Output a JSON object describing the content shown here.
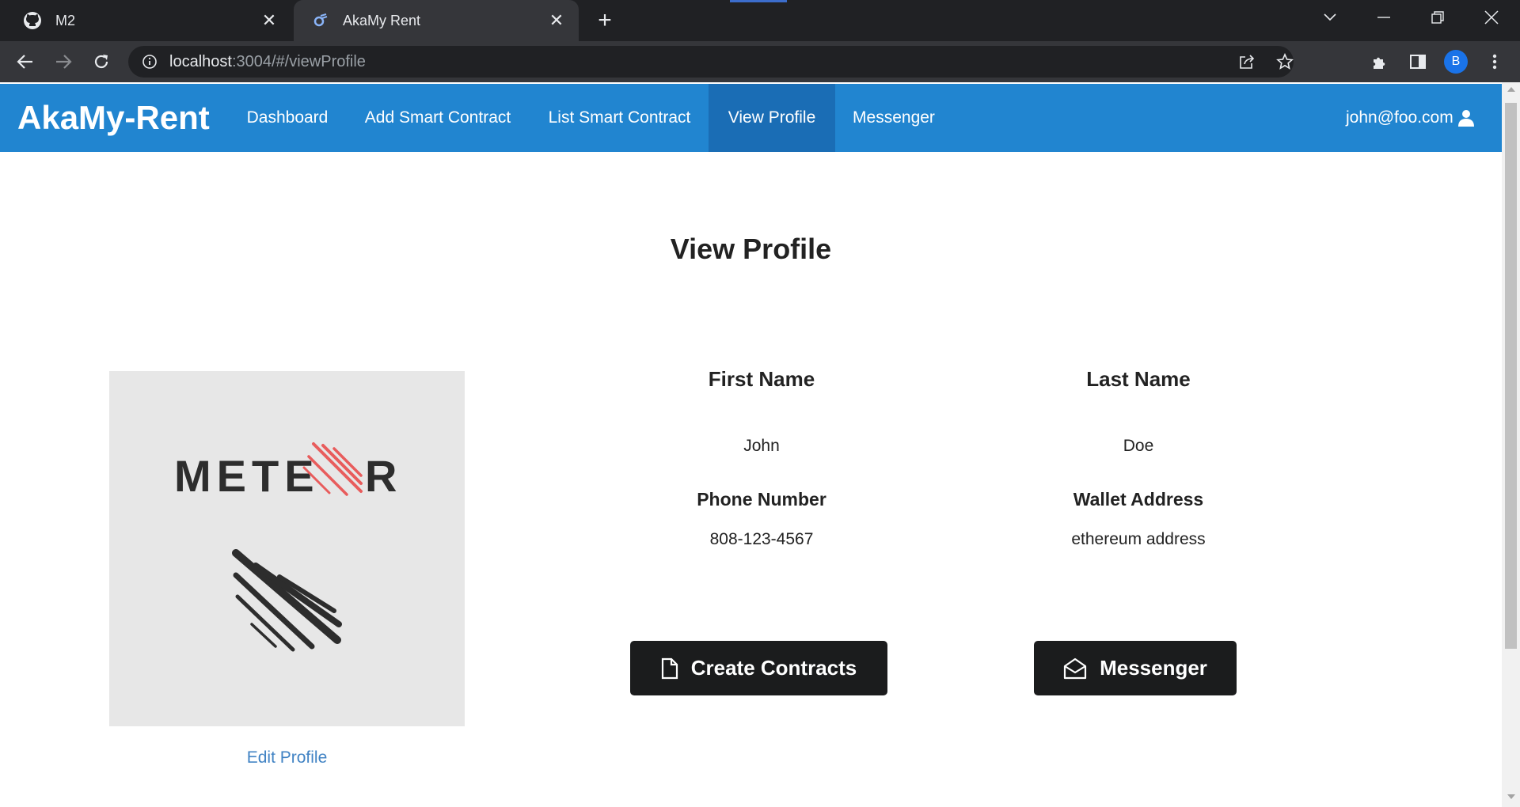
{
  "browser": {
    "tabs": [
      {
        "title": "M2",
        "icon": "github-icon"
      },
      {
        "title": "AkaMy Rent",
        "icon": "meteor-icon"
      }
    ],
    "address": {
      "host": "localhost",
      "path": ":3004/#/viewProfile"
    },
    "profile_initial": "B"
  },
  "app": {
    "brand": "AkaMy-Rent",
    "nav": {
      "dashboard": "Dashboard",
      "add_contract": "Add Smart Contract",
      "list_contract": "List Smart Contract",
      "view_profile": "View Profile",
      "messenger": "Messenger"
    },
    "user": "john@foo.com",
    "colors": {
      "navbar": "#2185d0",
      "navbar_active": "#1a6db5",
      "button": "#1b1c1d",
      "link": "#4183c4"
    }
  },
  "profile": {
    "heading": "View Profile",
    "image": {
      "wordmark": "METEOR"
    },
    "edit_link": "Edit Profile",
    "fields": {
      "first_name_label": "First Name",
      "first_name": "John",
      "last_name_label": "Last Name",
      "last_name": "Doe",
      "phone_label": "Phone Number",
      "phone": "808-123-4567",
      "wallet_label": "Wallet Address",
      "wallet": "ethereum address"
    },
    "buttons": {
      "create_contracts": "Create Contracts",
      "messenger": "Messenger"
    }
  }
}
